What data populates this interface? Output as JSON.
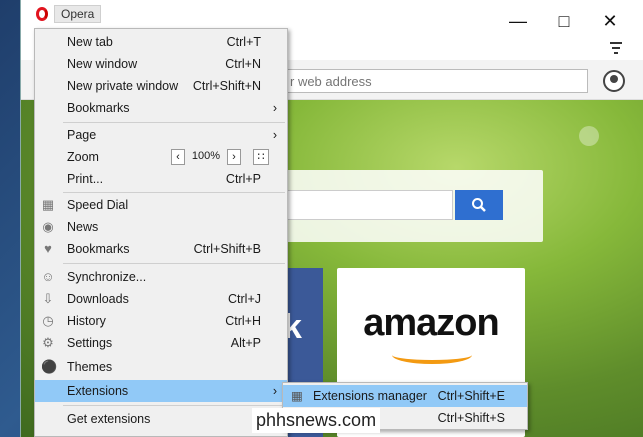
{
  "titlebar": {
    "opera_label": "Opera"
  },
  "address": {
    "placeholder": "r web address"
  },
  "speeddial": {
    "facebook_glyph": "k",
    "amazon_word": "amazon"
  },
  "menu": {
    "new_tab": {
      "label": "New tab",
      "shortcut": "Ctrl+T"
    },
    "new_window": {
      "label": "New window",
      "shortcut": "Ctrl+N"
    },
    "new_private": {
      "label": "New private window",
      "shortcut": "Ctrl+Shift+N"
    },
    "bookmarks_sub": {
      "label": "Bookmarks"
    },
    "page": {
      "label": "Page"
    },
    "zoom": {
      "label": "Zoom",
      "value": "100%"
    },
    "print": {
      "label": "Print...",
      "shortcut": "Ctrl+P"
    },
    "speed_dial": {
      "label": "Speed Dial"
    },
    "news": {
      "label": "News"
    },
    "bookmarks": {
      "label": "Bookmarks",
      "shortcut": "Ctrl+Shift+B"
    },
    "synchronize": {
      "label": "Synchronize..."
    },
    "downloads": {
      "label": "Downloads",
      "shortcut": "Ctrl+J"
    },
    "history": {
      "label": "History",
      "shortcut": "Ctrl+H"
    },
    "settings": {
      "label": "Settings",
      "shortcut": "Alt+P"
    },
    "themes": {
      "label": "Themes"
    },
    "extensions": {
      "label": "Extensions"
    },
    "get_extensions": {
      "label": "Get extensions"
    }
  },
  "submenu": {
    "manager": {
      "label": "Extensions manager",
      "shortcut": "Ctrl+Shift+E"
    },
    "second": {
      "shortcut": "Ctrl+Shift+S"
    }
  },
  "watermark": "phhsnews.com",
  "colors": {
    "highlight": "#91c9f7",
    "search_button": "#2f6fd0",
    "opera_red": "#e2141f"
  }
}
